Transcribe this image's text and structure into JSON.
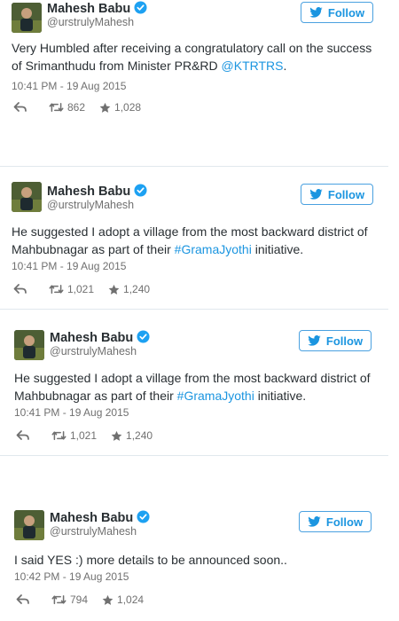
{
  "tweets": [
    {
      "name": "Mahesh Babu",
      "handle": "@urstrulyMahesh",
      "follow_label": "Follow",
      "text_prefix": "Very Humbled after receiving a congratulatory call on the success of Srimanthudu from Minister PR&RD ",
      "text_link": "@KTRTRS",
      "text_suffix": ".",
      "timestamp": "10:41 PM - 19 Aug 2015",
      "retweets": "862",
      "likes": "1,028"
    },
    {
      "name": "Mahesh Babu",
      "handle": "@urstrulyMahesh",
      "follow_label": "Follow",
      "text_prefix": "He suggested I adopt a village from the most backward district of Mahbubnagar as part of their ",
      "text_link": "#GramaJyothi",
      "text_suffix": " initiative.",
      "timestamp": "10:41 PM - 19 Aug 2015",
      "retweets": "1,021",
      "likes": "1,240"
    },
    {
      "name": "Mahesh Babu",
      "handle": "@urstrulyMahesh",
      "follow_label": "Follow",
      "text_prefix": "He suggested I adopt a village from the most backward district of Mahbubnagar as part of their ",
      "text_link": "#GramaJyothi",
      "text_suffix": " initiative.",
      "timestamp": "10:41 PM - 19 Aug 2015",
      "retweets": "1,021",
      "likes": "1,240"
    },
    {
      "name": "Mahesh Babu",
      "handle": "@urstrulyMahesh",
      "follow_label": "Follow",
      "text_prefix": "I said YES :) more details to be announced soon..",
      "text_link": "",
      "text_suffix": "",
      "timestamp": "10:42 PM - 19 Aug 2015",
      "retweets": "794",
      "likes": "1,024"
    }
  ],
  "icons": {
    "verified": "verified-badge-icon",
    "follow": "twitter-bird-icon",
    "reply": "reply-icon",
    "retweet": "retweet-icon",
    "like": "star-icon"
  },
  "colors": {
    "link": "#1b95e0",
    "verified": "#1da1f2",
    "meta": "#707070",
    "separator": "#e1e8ed"
  }
}
